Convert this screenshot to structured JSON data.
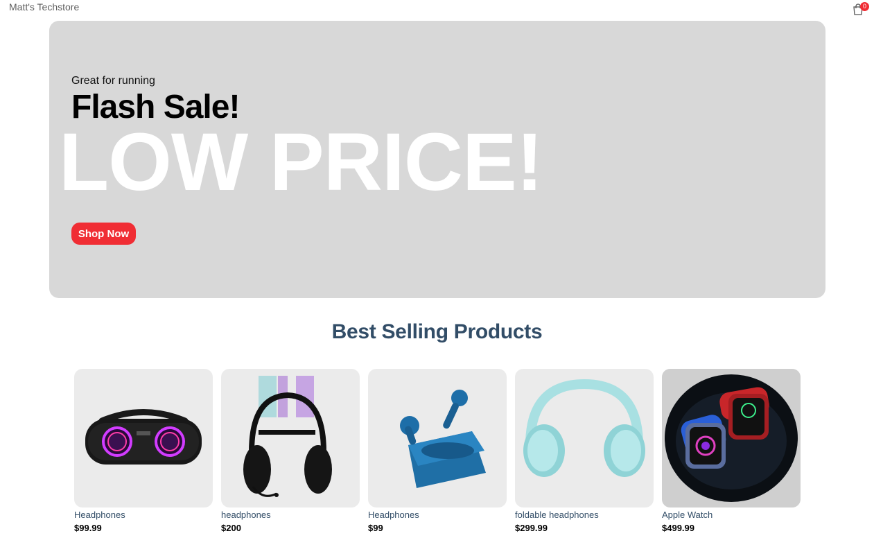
{
  "navbar": {
    "logo": "Matt's Techstore",
    "cart_icon": "shopping-bag-icon",
    "cart_qty": "0"
  },
  "hero": {
    "small_text": "Great for running",
    "mid_text": "Flash Sale!",
    "large_text": "LOW PRICE!",
    "button_label": "Shop Now"
  },
  "section": {
    "title": "Best Selling Products"
  },
  "products": [
    {
      "name": "Headphones",
      "price": "$99.99",
      "image": "speaker-image"
    },
    {
      "name": "headphones",
      "price": "$200",
      "image": "gaming-headset-image"
    },
    {
      "name": "Headphones",
      "price": "$99",
      "image": "earbuds-image"
    },
    {
      "name": "foldable headphones",
      "price": "$299.99",
      "image": "foldable-headphones-image"
    },
    {
      "name": "Apple Watch",
      "price": "$499.99",
      "image": "smartwatch-image"
    }
  ],
  "colors": {
    "accent": "#f02d34",
    "heading": "#324d67",
    "hero_bg": "#d8d8d8",
    "card_bg": "#ebebeb"
  }
}
